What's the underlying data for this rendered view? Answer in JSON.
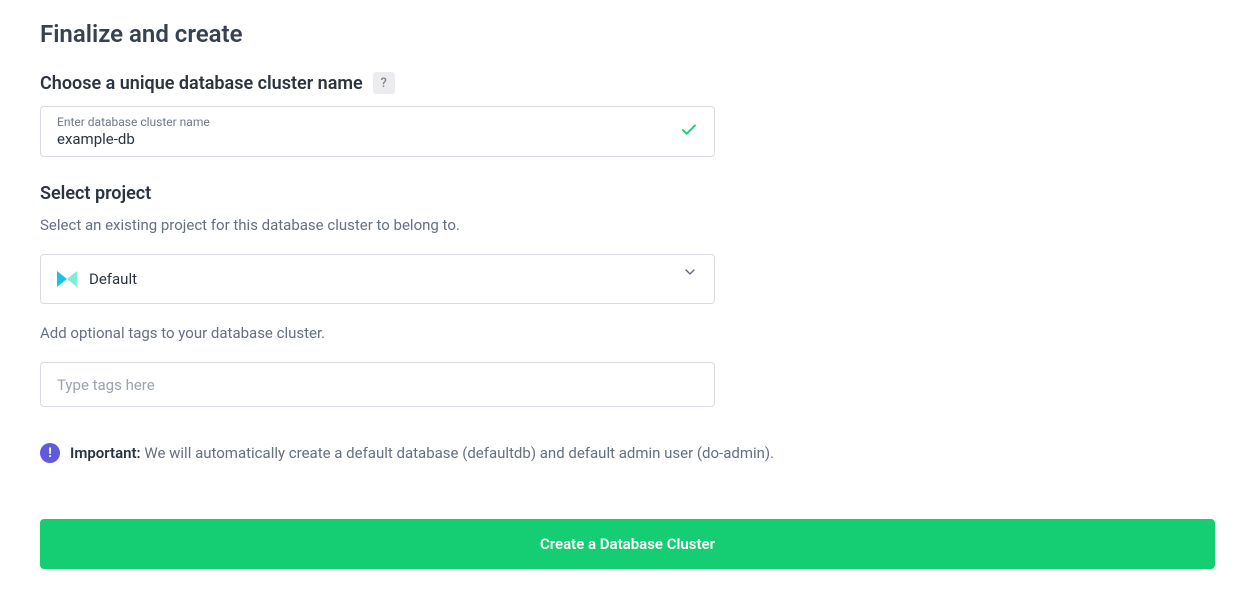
{
  "heading": "Finalize and create",
  "cluster_name_section": {
    "label": "Choose a unique database cluster name",
    "help_symbol": "?",
    "placeholder_label": "Enter database cluster name",
    "value": "example-db"
  },
  "project_section": {
    "label": "Select project",
    "description": "Select an existing project for this database cluster to belong to.",
    "selected": "Default"
  },
  "tags_section": {
    "description": "Add optional tags to your database cluster.",
    "placeholder": "Type tags here"
  },
  "note": {
    "important_label": "Important:",
    "text": "We will automatically create a default database (defaultdb) and default admin user (do-admin)."
  },
  "submit_label": "Create a Database Cluster"
}
